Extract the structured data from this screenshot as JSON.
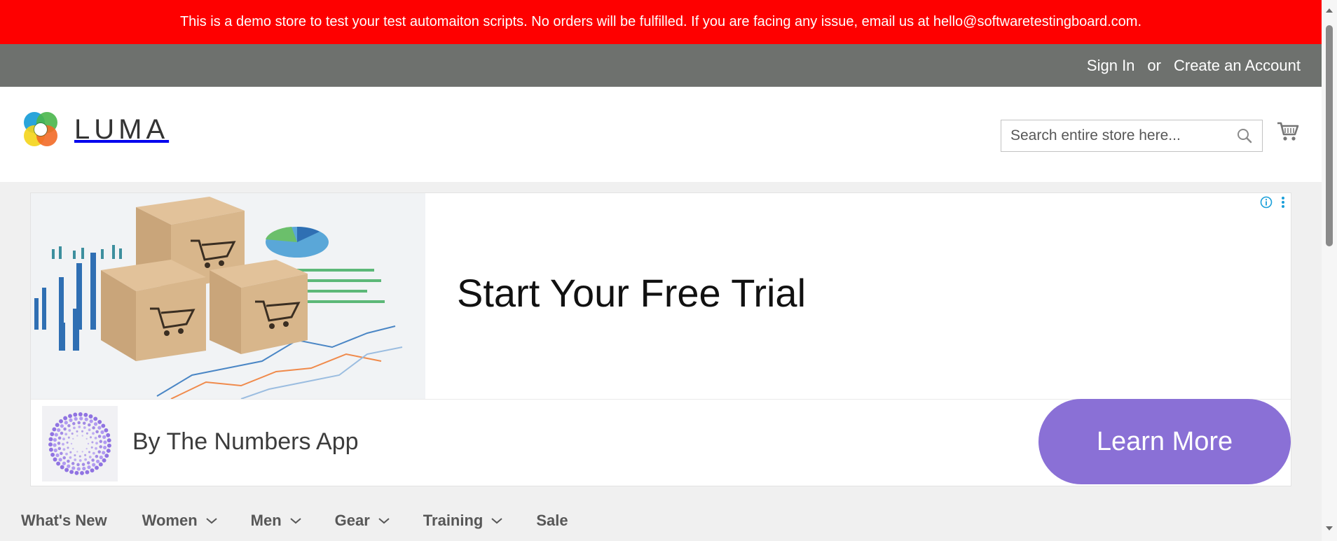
{
  "notice": {
    "text": "This is a demo store to test your test automaiton scripts. No orders will be fulfilled. If you are facing any issue, email us at hello@softwaretestingboard.com."
  },
  "top_links": {
    "sign_in": "Sign In",
    "separator": "or",
    "create_account": "Create an Account"
  },
  "header": {
    "logo_text": "LUMA",
    "search_placeholder": "Search entire store here...",
    "search_icon": "search-icon",
    "cart_icon": "cart-icon"
  },
  "ad": {
    "headline": "Start Your Free Trial",
    "advertiser": "By The Numbers App",
    "cta_label": "Learn More",
    "info_icon": "info-icon",
    "menu_icon": "more-vertical-icon",
    "cta_color": "#8a70d6"
  },
  "nav": {
    "items": [
      {
        "label": "What's New",
        "has_dropdown": false
      },
      {
        "label": "Women",
        "has_dropdown": true
      },
      {
        "label": "Men",
        "has_dropdown": true
      },
      {
        "label": "Gear",
        "has_dropdown": true
      },
      {
        "label": "Training",
        "has_dropdown": true
      },
      {
        "label": "Sale",
        "has_dropdown": false
      }
    ]
  },
  "colors": {
    "notice_bg": "#fe0000",
    "top_bar_bg": "#6e716e",
    "page_bg": "#f0f0f0"
  }
}
